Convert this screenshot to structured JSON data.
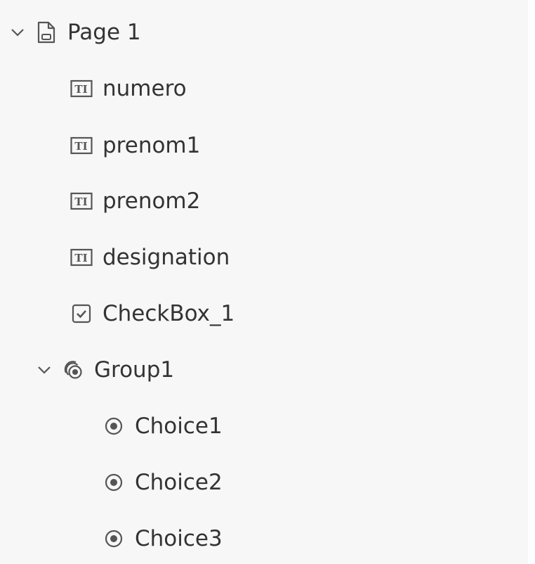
{
  "tree": {
    "page": {
      "label": "Page 1",
      "icon": "page-icon",
      "expanded": true,
      "children": [
        {
          "label": "numero",
          "icon": "text-field-icon"
        },
        {
          "label": "prenom1",
          "icon": "text-field-icon"
        },
        {
          "label": "prenom2",
          "icon": "text-field-icon"
        },
        {
          "label": "designation",
          "icon": "text-field-icon"
        },
        {
          "label": "CheckBox_1",
          "icon": "checkbox-icon"
        }
      ],
      "group": {
        "label": "Group1",
        "icon": "radio-group-icon",
        "expanded": true,
        "children": [
          {
            "label": "Choice1",
            "icon": "radio-button-icon"
          },
          {
            "label": "Choice2",
            "icon": "radio-button-icon"
          },
          {
            "label": "Choice3",
            "icon": "radio-button-icon"
          }
        ]
      }
    }
  },
  "colors": {
    "panel_bg": "#f7f7f7",
    "text": "#333333",
    "icon": "#555555"
  }
}
